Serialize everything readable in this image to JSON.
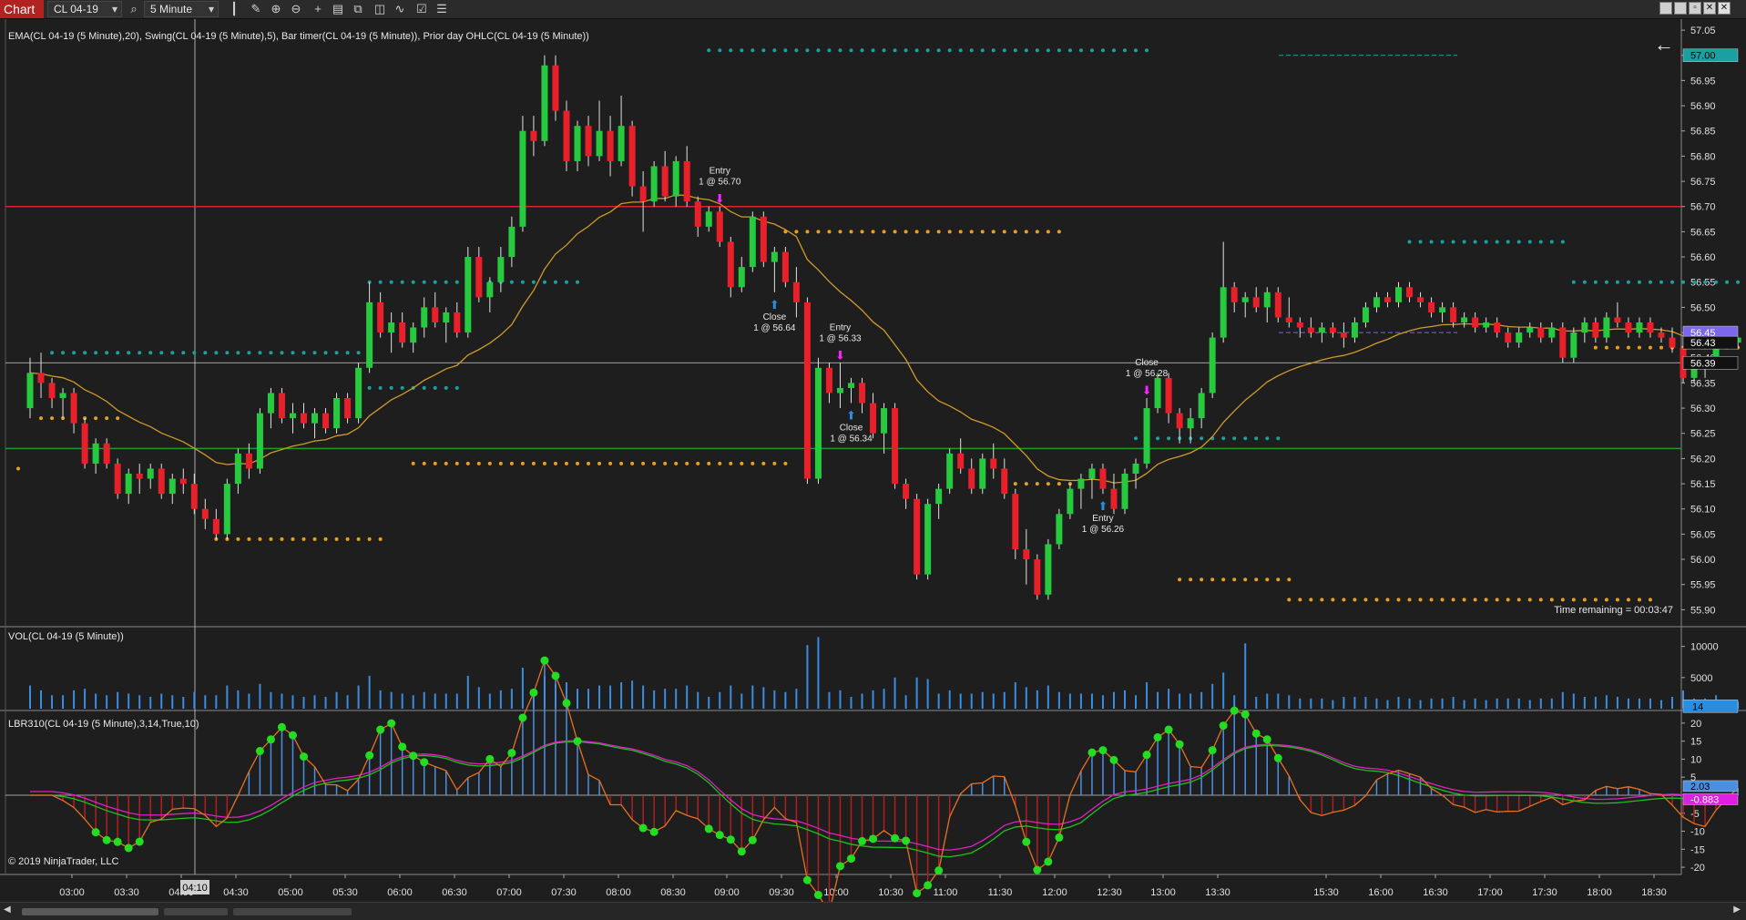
{
  "toolbar": {
    "app_tab": "Chart",
    "instrument": "CL 04-19",
    "interval": "5 Minute",
    "icons": [
      "search-icon",
      "bar-style-icon",
      "draw-pencil-icon",
      "zoom-in-icon",
      "zoom-out-icon",
      "crosshair-icon",
      "data-box-icon",
      "chart-trader-icon",
      "indicators-icon",
      "strategies-icon",
      "properties-icon"
    ],
    "window_buttons": [
      "minimize",
      "restore",
      "maximize",
      "close"
    ]
  },
  "labels": {
    "price_panel": "EMA(CL 04-19 (5 Minute),20), Swing(CL 04-19 (5 Minute),5), Bar timer(CL 04-19 (5 Minute)), Prior day OHLC(CL 04-19 (5 Minute))",
    "vol_panel": "VOL(CL 04-19 (5 Minute))",
    "osc_panel": "LBR310(CL 04-19 (5 Minute),3,14,True,10)",
    "copyright": "© 2019 NinjaTrader, LLC",
    "time_remaining": "Time remaining = 00:03:47"
  },
  "colors": {
    "up": "#27c93f",
    "down": "#e8202a",
    "ema": "#d09a2a",
    "swing_high": "#1aa0a0",
    "swing_low": "#e8a020",
    "prior_high": "#e0202a",
    "prior_low": "#1e9a2a",
    "vol": "#3a8de0",
    "lbr_fast": "#e87020",
    "lbr_slow": "#e020c0",
    "lbr_signal": "#20c020"
  },
  "price_axis": {
    "ticks": [
      "57.05",
      "57.00",
      "56.95",
      "56.90",
      "56.85",
      "56.80",
      "56.75",
      "56.70",
      "56.65",
      "56.60",
      "56.55",
      "56.50",
      "56.45",
      "56.40",
      "56.35",
      "56.30",
      "56.25",
      "56.20",
      "56.15",
      "56.10",
      "56.05",
      "56.00",
      "55.95",
      "55.90"
    ],
    "min": 55.87,
    "max": 57.07,
    "markers": [
      {
        "value": "57.00",
        "bg": "#1aa0a0",
        "fg": "#000000",
        "price": 57.0
      },
      {
        "value": "56.45",
        "bg": "#7b68ee",
        "fg": "#ffffff",
        "price": 56.45
      },
      {
        "value": "56.43",
        "bg": "#111111",
        "fg": "#ffffff",
        "price": 56.43
      },
      {
        "value": "56.39",
        "bg": "#111111",
        "fg": "#ffffff",
        "price": 56.39
      }
    ]
  },
  "vol_axis": {
    "ticks": [
      "10000",
      "5000"
    ],
    "marker": "14",
    "max": 12000
  },
  "osc_axis": {
    "ticks": [
      "20",
      "15",
      "10",
      "5",
      "-5",
      "-10",
      "-15",
      "-20"
    ],
    "markers": [
      "2.03",
      "-0.883"
    ],
    "min": -22,
    "max": 23
  },
  "time_axis": {
    "ticks": [
      "03:00",
      "03:30",
      "04:00",
      "04:30",
      "05:00",
      "05:30",
      "06:00",
      "06:30",
      "07:00",
      "07:30",
      "08:00",
      "08:30",
      "09:00",
      "09:30",
      "10:00",
      "10:30",
      "11:00",
      "11:30",
      "12:00",
      "12:30",
      "13:00",
      "13:30",
      "15:30",
      "16:00",
      "16:30",
      "17:00",
      "17:30",
      "18:00",
      "18:30"
    ],
    "crosshair_label": "04:10"
  },
  "chart_data": {
    "type": "candlestick",
    "symbol": "CL 04-19",
    "interval": "5 Minute",
    "prior_day_high": 56.7,
    "prior_day_low": 56.22,
    "crosshair_price": 56.39,
    "candles": [
      [
        56.3,
        56.4,
        56.28,
        56.37
      ],
      [
        56.37,
        56.41,
        56.32,
        56.35
      ],
      [
        56.35,
        56.36,
        56.3,
        56.32
      ],
      [
        56.32,
        56.34,
        56.28,
        56.33
      ],
      [
        56.33,
        56.34,
        56.25,
        56.27
      ],
      [
        56.27,
        56.28,
        56.18,
        56.19
      ],
      [
        56.19,
        56.24,
        56.17,
        56.23
      ],
      [
        56.23,
        56.24,
        56.18,
        56.19
      ],
      [
        56.19,
        56.2,
        56.12,
        56.13
      ],
      [
        56.13,
        56.18,
        56.11,
        56.17
      ],
      [
        56.17,
        56.19,
        56.13,
        56.16
      ],
      [
        56.16,
        56.19,
        56.14,
        56.18
      ],
      [
        56.18,
        56.19,
        56.12,
        56.13
      ],
      [
        56.13,
        56.17,
        56.11,
        56.16
      ],
      [
        56.16,
        56.18,
        56.13,
        56.15
      ],
      [
        56.15,
        56.17,
        56.09,
        56.1
      ],
      [
        56.1,
        56.12,
        56.06,
        56.08
      ],
      [
        56.08,
        56.1,
        56.04,
        56.05
      ],
      [
        56.05,
        56.16,
        56.04,
        56.15
      ],
      [
        56.15,
        56.22,
        56.13,
        56.21
      ],
      [
        56.21,
        56.23,
        56.16,
        56.18
      ],
      [
        56.18,
        56.3,
        56.17,
        56.29
      ],
      [
        56.29,
        56.34,
        56.26,
        56.33
      ],
      [
        56.33,
        56.34,
        56.27,
        56.28
      ],
      [
        56.28,
        56.31,
        56.25,
        56.29
      ],
      [
        56.29,
        56.31,
        56.26,
        56.27
      ],
      [
        56.27,
        56.3,
        56.24,
        56.29
      ],
      [
        56.29,
        56.3,
        56.25,
        56.26
      ],
      [
        56.26,
        56.33,
        56.25,
        56.32
      ],
      [
        56.32,
        56.33,
        56.27,
        56.28
      ],
      [
        56.28,
        56.39,
        56.27,
        56.38
      ],
      [
        56.38,
        56.55,
        56.37,
        56.51
      ],
      [
        56.51,
        56.53,
        56.44,
        56.45
      ],
      [
        56.45,
        56.49,
        56.41,
        56.47
      ],
      [
        56.47,
        56.49,
        56.42,
        56.43
      ],
      [
        56.43,
        56.47,
        56.41,
        56.46
      ],
      [
        56.46,
        56.52,
        56.44,
        56.5
      ],
      [
        56.5,
        56.53,
        56.46,
        56.47
      ],
      [
        56.47,
        56.5,
        56.43,
        56.49
      ],
      [
        56.49,
        56.51,
        56.44,
        56.45
      ],
      [
        56.45,
        56.62,
        56.44,
        56.6
      ],
      [
        56.6,
        56.62,
        56.51,
        56.52
      ],
      [
        56.52,
        56.56,
        56.49,
        56.55
      ],
      [
        56.55,
        56.62,
        56.53,
        56.6
      ],
      [
        56.6,
        56.68,
        56.58,
        56.66
      ],
      [
        56.66,
        56.88,
        56.65,
        56.85
      ],
      [
        56.85,
        56.88,
        56.8,
        56.83
      ],
      [
        56.83,
        57.0,
        56.82,
        56.98
      ],
      [
        56.98,
        57.0,
        56.87,
        56.89
      ],
      [
        56.89,
        56.91,
        56.77,
        56.79
      ],
      [
        56.79,
        56.87,
        56.77,
        56.86
      ],
      [
        56.86,
        56.88,
        56.78,
        56.8
      ],
      [
        56.8,
        56.91,
        56.79,
        56.85
      ],
      [
        56.85,
        56.88,
        56.76,
        56.79
      ],
      [
        56.79,
        56.92,
        56.78,
        56.86
      ],
      [
        56.86,
        56.87,
        56.72,
        56.74
      ],
      [
        56.74,
        56.77,
        56.65,
        56.71
      ],
      [
        56.71,
        56.79,
        56.7,
        56.78
      ],
      [
        56.78,
        56.81,
        56.71,
        56.72
      ],
      [
        56.72,
        56.8,
        56.7,
        56.79
      ],
      [
        56.79,
        56.82,
        56.7,
        56.71
      ],
      [
        56.71,
        56.72,
        56.64,
        56.66
      ],
      [
        56.66,
        56.7,
        56.65,
        56.69
      ],
      [
        56.69,
        56.7,
        56.62,
        56.63
      ],
      [
        56.63,
        56.64,
        56.52,
        56.54
      ],
      [
        56.54,
        56.6,
        56.53,
        56.58
      ],
      [
        56.58,
        56.69,
        56.57,
        56.68
      ],
      [
        56.68,
        56.69,
        56.58,
        56.59
      ],
      [
        56.59,
        56.62,
        56.53,
        56.61
      ],
      [
        56.61,
        56.62,
        56.54,
        56.55
      ],
      [
        56.55,
        56.58,
        56.48,
        56.51
      ],
      [
        56.51,
        56.52,
        56.15,
        56.16
      ],
      [
        56.16,
        56.4,
        56.15,
        56.38
      ],
      [
        56.38,
        56.39,
        56.31,
        56.33
      ],
      [
        56.33,
        56.39,
        56.3,
        56.34
      ],
      [
        56.34,
        56.36,
        56.31,
        56.35
      ],
      [
        56.35,
        56.36,
        56.29,
        56.31
      ],
      [
        56.31,
        56.33,
        56.24,
        56.25
      ],
      [
        56.25,
        56.31,
        56.21,
        56.3
      ],
      [
        56.3,
        56.31,
        56.14,
        56.15
      ],
      [
        56.15,
        56.16,
        56.1,
        56.12
      ],
      [
        56.12,
        56.13,
        55.96,
        55.97
      ],
      [
        55.97,
        56.12,
        55.96,
        56.11
      ],
      [
        56.11,
        56.15,
        56.08,
        56.14
      ],
      [
        56.14,
        56.22,
        56.13,
        56.21
      ],
      [
        56.21,
        56.24,
        56.17,
        56.18
      ],
      [
        56.18,
        56.2,
        56.13,
        56.14
      ],
      [
        56.14,
        56.21,
        56.13,
        56.2
      ],
      [
        56.2,
        56.23,
        56.16,
        56.18
      ],
      [
        56.18,
        56.2,
        56.12,
        56.13
      ],
      [
        56.13,
        56.14,
        56.0,
        56.02
      ],
      [
        56.02,
        56.06,
        55.95,
        56.0
      ],
      [
        56.0,
        56.01,
        55.92,
        55.93
      ],
      [
        55.93,
        56.04,
        55.92,
        56.03
      ],
      [
        56.03,
        56.1,
        56.02,
        56.09
      ],
      [
        56.09,
        56.15,
        56.08,
        56.14
      ],
      [
        56.14,
        56.17,
        56.1,
        56.16
      ],
      [
        56.16,
        56.19,
        56.12,
        56.18
      ],
      [
        56.18,
        56.19,
        56.13,
        56.14
      ],
      [
        56.14,
        56.17,
        56.09,
        56.1
      ],
      [
        56.1,
        56.18,
        56.09,
        56.17
      ],
      [
        56.17,
        56.2,
        56.14,
        56.19
      ],
      [
        56.19,
        56.32,
        56.18,
        56.3
      ],
      [
        56.3,
        56.37,
        56.29,
        56.36
      ],
      [
        56.36,
        56.37,
        56.27,
        56.29
      ],
      [
        56.29,
        56.3,
        56.23,
        56.26
      ],
      [
        56.26,
        56.3,
        56.23,
        56.28
      ],
      [
        56.28,
        56.34,
        56.26,
        56.33
      ],
      [
        56.33,
        56.45,
        56.32,
        56.44
      ],
      [
        56.44,
        56.63,
        56.43,
        56.54
      ],
      [
        56.54,
        56.55,
        56.49,
        56.51
      ],
      [
        56.51,
        56.53,
        56.48,
        56.52
      ],
      [
        56.52,
        56.54,
        56.49,
        56.5
      ],
      [
        56.5,
        56.54,
        56.47,
        56.53
      ],
      [
        56.53,
        56.54,
        56.47,
        56.48
      ],
      [
        56.48,
        56.52,
        56.46,
        56.47
      ],
      [
        56.47,
        56.48,
        56.44,
        56.46
      ],
      [
        56.46,
        56.48,
        56.44,
        56.45
      ],
      [
        56.45,
        56.47,
        56.43,
        56.46
      ],
      [
        56.46,
        56.47,
        56.44,
        56.45
      ],
      [
        56.45,
        56.47,
        56.42,
        56.44
      ],
      [
        56.44,
        56.48,
        56.43,
        56.47
      ],
      [
        56.47,
        56.51,
        56.46,
        56.5
      ],
      [
        56.5,
        56.53,
        56.49,
        56.52
      ],
      [
        56.52,
        56.53,
        56.5,
        56.51
      ],
      [
        56.51,
        56.55,
        56.5,
        56.54
      ],
      [
        56.54,
        56.55,
        56.51,
        56.52
      ],
      [
        56.52,
        56.53,
        56.5,
        56.51
      ],
      [
        56.51,
        56.52,
        56.48,
        56.49
      ],
      [
        56.49,
        56.51,
        56.47,
        56.5
      ],
      [
        56.5,
        56.51,
        56.46,
        56.47
      ],
      [
        56.47,
        56.49,
        56.46,
        56.48
      ],
      [
        56.48,
        56.49,
        56.45,
        56.46
      ],
      [
        56.46,
        56.48,
        56.45,
        56.47
      ],
      [
        56.47,
        56.48,
        56.44,
        56.45
      ],
      [
        56.45,
        56.46,
        56.42,
        56.43
      ],
      [
        56.43,
        56.46,
        56.42,
        56.45
      ],
      [
        56.45,
        56.47,
        56.44,
        56.46
      ],
      [
        56.46,
        56.47,
        56.43,
        56.44
      ],
      [
        56.44,
        56.47,
        56.43,
        56.46
      ],
      [
        56.46,
        56.47,
        56.39,
        56.4
      ],
      [
        56.4,
        56.46,
        56.39,
        56.45
      ],
      [
        56.45,
        56.48,
        56.43,
        56.47
      ],
      [
        56.47,
        56.48,
        56.43,
        56.44
      ],
      [
        56.44,
        56.49,
        56.43,
        56.48
      ],
      [
        56.48,
        56.51,
        56.46,
        56.47
      ],
      [
        56.47,
        56.48,
        56.44,
        56.45
      ],
      [
        56.45,
        56.48,
        56.44,
        56.47
      ],
      [
        56.47,
        56.48,
        56.44,
        56.45
      ],
      [
        56.45,
        56.46,
        56.43,
        56.44
      ],
      [
        56.44,
        56.46,
        56.41,
        56.42
      ],
      [
        56.42,
        56.44,
        56.35,
        56.36
      ],
      [
        56.36,
        56.39,
        56.35,
        56.38
      ],
      [
        56.38,
        56.4,
        56.36,
        56.39
      ],
      [
        56.39,
        56.44,
        56.38,
        56.43
      ],
      [
        56.43,
        56.44,
        56.42,
        56.43
      ],
      [
        56.43,
        56.44,
        56.42,
        56.44
      ]
    ],
    "swing_highs": [
      [
        2,
        30,
        56.41
      ],
      [
        31,
        50,
        56.55
      ],
      [
        30,
        39,
        56.34
      ],
      [
        62,
        102,
        57.01
      ],
      [
        126,
        140,
        56.63
      ],
      [
        101,
        114,
        56.24
      ],
      [
        141,
        160,
        56.55
      ],
      [
        163,
        176,
        56.51
      ]
    ],
    "swing_lows": [
      [
        1,
        8,
        56.28
      ],
      [
        17,
        32,
        56.04
      ],
      [
        35,
        69,
        56.19
      ],
      [
        69,
        94,
        56.65
      ],
      [
        89,
        96,
        56.15
      ],
      [
        105,
        115,
        55.96
      ],
      [
        115,
        148,
        55.92
      ],
      [
        143,
        168,
        56.42
      ],
      [
        162,
        178,
        56.37
      ],
      [
        177,
        186,
        56.35
      ]
    ],
    "trades": [
      {
        "label": "Entry",
        "price_text": "1 @ 56.70",
        "type": "entry-short",
        "bar": 63
      },
      {
        "label": "Close",
        "price_text": "1 @ 56.64",
        "type": "close-long",
        "bar": 68
      },
      {
        "label": "Entry",
        "price_text": "1 @ 56.33",
        "type": "entry-short",
        "bar": 74
      },
      {
        "label": "Close",
        "price_text": "1 @ 56.34",
        "type": "close-long",
        "bar": 75
      },
      {
        "label": "Close",
        "price_text": "1 @ 56.28",
        "type": "close-short",
        "bar": 102
      },
      {
        "label": "Entry",
        "price_text": "1 @ 56.26",
        "type": "entry-long",
        "bar": 98
      }
    ]
  }
}
